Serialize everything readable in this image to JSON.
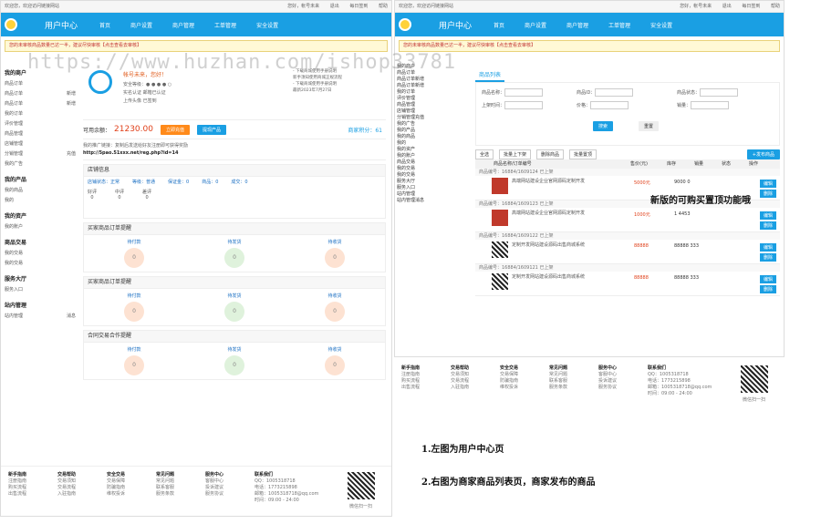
{
  "left": {
    "topbar_left": "欢迎您，欢迎访问链接网站",
    "topbar_right": [
      "您好，帐号未来",
      "退出",
      "每日签到",
      "帮助"
    ],
    "title": "用户中心",
    "nav": [
      "首页",
      "商户设置",
      "商户管理",
      "工单管理",
      "安全设置"
    ],
    "notice": "您的未审核商品数量已达一半，建议尽快审核【点击查看去审核】",
    "sidebar": [
      {
        "head": "我的商户"
      },
      {
        "label": "商品订单",
        "extra": ""
      },
      {
        "label": "商品订单",
        "extra": "新增"
      },
      {
        "label": "商品订单",
        "extra": "新增"
      },
      {
        "label": "我的订单",
        "extra": ""
      },
      {
        "label": "评价管理",
        "extra": ""
      },
      {
        "label": "商品管理",
        "extra": ""
      },
      {
        "label": "店铺管理",
        "extra": ""
      },
      {
        "label": "分销管理",
        "extra": "充值"
      },
      {
        "label": "我的广告",
        "extra": ""
      },
      {
        "head": "我的产品"
      },
      {
        "label": "我的商品",
        "extra": ""
      },
      {
        "label": "我的",
        "extra": ""
      },
      {
        "head": "我的资产"
      },
      {
        "label": "我的账户",
        "extra": ""
      },
      {
        "head": "商品交易"
      },
      {
        "label": "我的交易",
        "extra": ""
      },
      {
        "label": "我的交易",
        "extra": ""
      },
      {
        "head": "服务大厅"
      },
      {
        "label": "服务入口",
        "extra": ""
      },
      {
        "head": "站内管理"
      },
      {
        "label": "站内管理",
        "extra": "消息"
      }
    ],
    "welcome": "帐号未来，您好！",
    "profile_lines": [
      "安全等级：● ● ● ● ○",
      "实名认证    邮箱已认证",
      "上传头像    已签到"
    ],
    "profile_right": [
      "- 下载商城使用手册说明",
      "新手须知使用商城正规流程",
      "- 下载商城使用手册说明",
      "最新2023年7月27日"
    ],
    "money_label": "可用余额：",
    "money_value": "21230.00",
    "btn_recharge": "立即充值",
    "btn_withdraw": "提现产品",
    "score_label": "商家积分：61",
    "url_hint": "我的推广链接：复制后发送给好友注册即可获得奖励",
    "url_value": "http://5pao.51xxx.net/reg.php?id=14",
    "sec1": "店铺信息",
    "sec1_row": [
      "店铺状态：正常",
      "等级：普通",
      "保证金：0",
      "商品：0",
      "成交：0"
    ],
    "sec1_stats": [
      {
        "label": "好评",
        "value": "0"
      },
      {
        "label": "中评",
        "value": "0"
      },
      {
        "label": "差评",
        "value": "0"
      }
    ],
    "sec2": "买家商品订单提醒",
    "sec2_items": [
      {
        "label": "待付款",
        "value": "0"
      },
      {
        "label": "待发货",
        "value": "0"
      },
      {
        "label": "待收货",
        "value": "0"
      }
    ],
    "sec3": "买家商品订单提醒",
    "sec3_items": [
      {
        "label": "待付款",
        "value": "0"
      },
      {
        "label": "待发货",
        "value": "0"
      },
      {
        "label": "待收货",
        "value": "0"
      }
    ],
    "sec4": "合同交易合作提醒",
    "sec4_items": [
      {
        "label": "待付款",
        "value": "0"
      },
      {
        "label": "待发货",
        "value": "0"
      },
      {
        "label": "待收货",
        "value": "0"
      }
    ],
    "footer_cols": [
      {
        "title": "新手指南",
        "items": [
          "注册指南",
          "购买流程",
          "出售流程"
        ]
      },
      {
        "title": "交易帮助",
        "items": [
          "交易须知",
          "交易流程",
          "入驻指南"
        ]
      },
      {
        "title": "安全交易",
        "items": [
          "交易保障",
          "防骗指南",
          "维权投诉"
        ]
      },
      {
        "title": "常见问题",
        "items": [
          "常见问题",
          "联系客服",
          "服务条款"
        ]
      },
      {
        "title": "服务中心",
        "items": [
          "客服中心",
          "投诉建议",
          "服务协议"
        ]
      },
      {
        "title": "联系我们",
        "items": [
          "QQ：1005318718",
          "电话：1773215898",
          "邮箱：1005318718@qq.com",
          "时间：09:00 - 24:00"
        ]
      }
    ],
    "qr_label": "微信扫一扫"
  },
  "right": {
    "title": "用户中心",
    "tab": "商品列表",
    "search_fields": [
      "商品名称：",
      "商品ID：",
      "商品状态：",
      "上架时间：",
      "价格：",
      "销量："
    ],
    "status_value": "--全部--",
    "btn_search": "搜索",
    "btn_reset": "重置",
    "actions": [
      "全选",
      "批量上下架",
      "删除商品",
      "批量置顶"
    ],
    "add_button": "+发布商品",
    "thead": [
      "商品名称/订单编号",
      "售价(元)",
      "库存",
      "销量",
      "状态",
      "操作"
    ],
    "items": [
      {
        "id": "商品编号：16884/1609124",
        "title": "高端网站建设企业官网源码定制开发",
        "price": "5000元",
        "stock": "9000",
        "sales": "0",
        "status": "已上架"
      },
      {
        "id": "商品编号：16884/1609123",
        "title": "高端网站建设企业官网源码定制开发",
        "price": "1000元",
        "stock": "1",
        "sales": "4453",
        "status": "已上架"
      },
      {
        "id": "商品编号：16884/1609122",
        "title": "定制开发网站建设源码出售商城系统",
        "price": "88888",
        "stock": "88888",
        "sales": "333",
        "status": "已上架"
      },
      {
        "id": "商品编号：16884/1609121",
        "title": "定制开发网站建设源码出售商城系统",
        "price": "88888",
        "stock": "88888",
        "sales": "333",
        "status": "已上架"
      }
    ],
    "op_edit": "编辑",
    "op_delete": "删除",
    "op_top": "立即置顶",
    "promo": "新版的可购买置顶功能哦"
  },
  "captions": [
    "1.左图为用户中心页",
    "2.右图为商家商品列表页，商家发布的商品"
  ],
  "watermark": "https://www.huzhan.com/ishop33781",
  "colors": {
    "brand": "#1a9fe3",
    "accent": "#ff8a1a",
    "price": "#e0401a"
  }
}
